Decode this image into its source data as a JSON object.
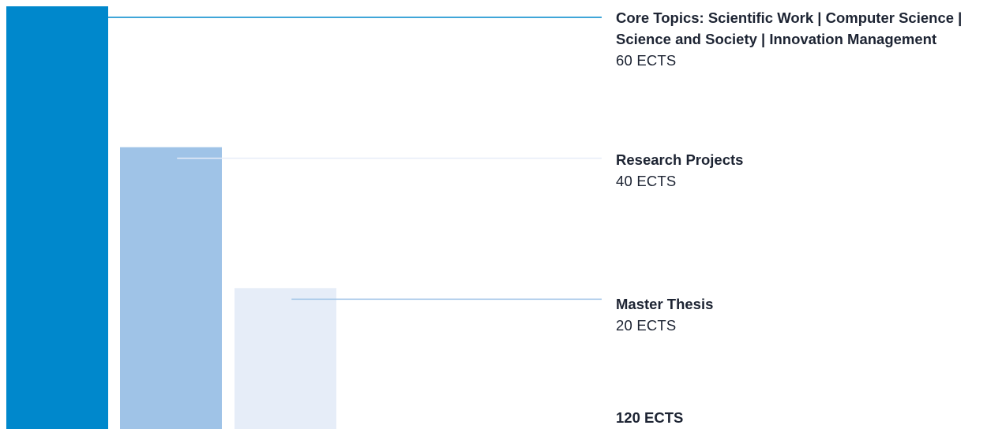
{
  "chart_data": {
    "type": "bar",
    "unit": "ECTS",
    "categories": [
      "Core Topics: Scientific Work | Computer Science | Science and Society | Innovation Management",
      "Research Projects",
      "Master Thesis"
    ],
    "values": [
      60,
      40,
      20
    ],
    "value_labels": [
      "60 ECTS",
      "40 ECTS",
      "20 ECTS"
    ],
    "colors": [
      "#0088cc",
      "#9fc3e7",
      "#e6edf8"
    ],
    "connector_colors": [
      "#0088cc",
      "#e6edf8",
      "#9fc3e7"
    ],
    "ylim": [
      0,
      60
    ],
    "grid": false,
    "legend": "none",
    "total_label": "120 ECTS"
  }
}
